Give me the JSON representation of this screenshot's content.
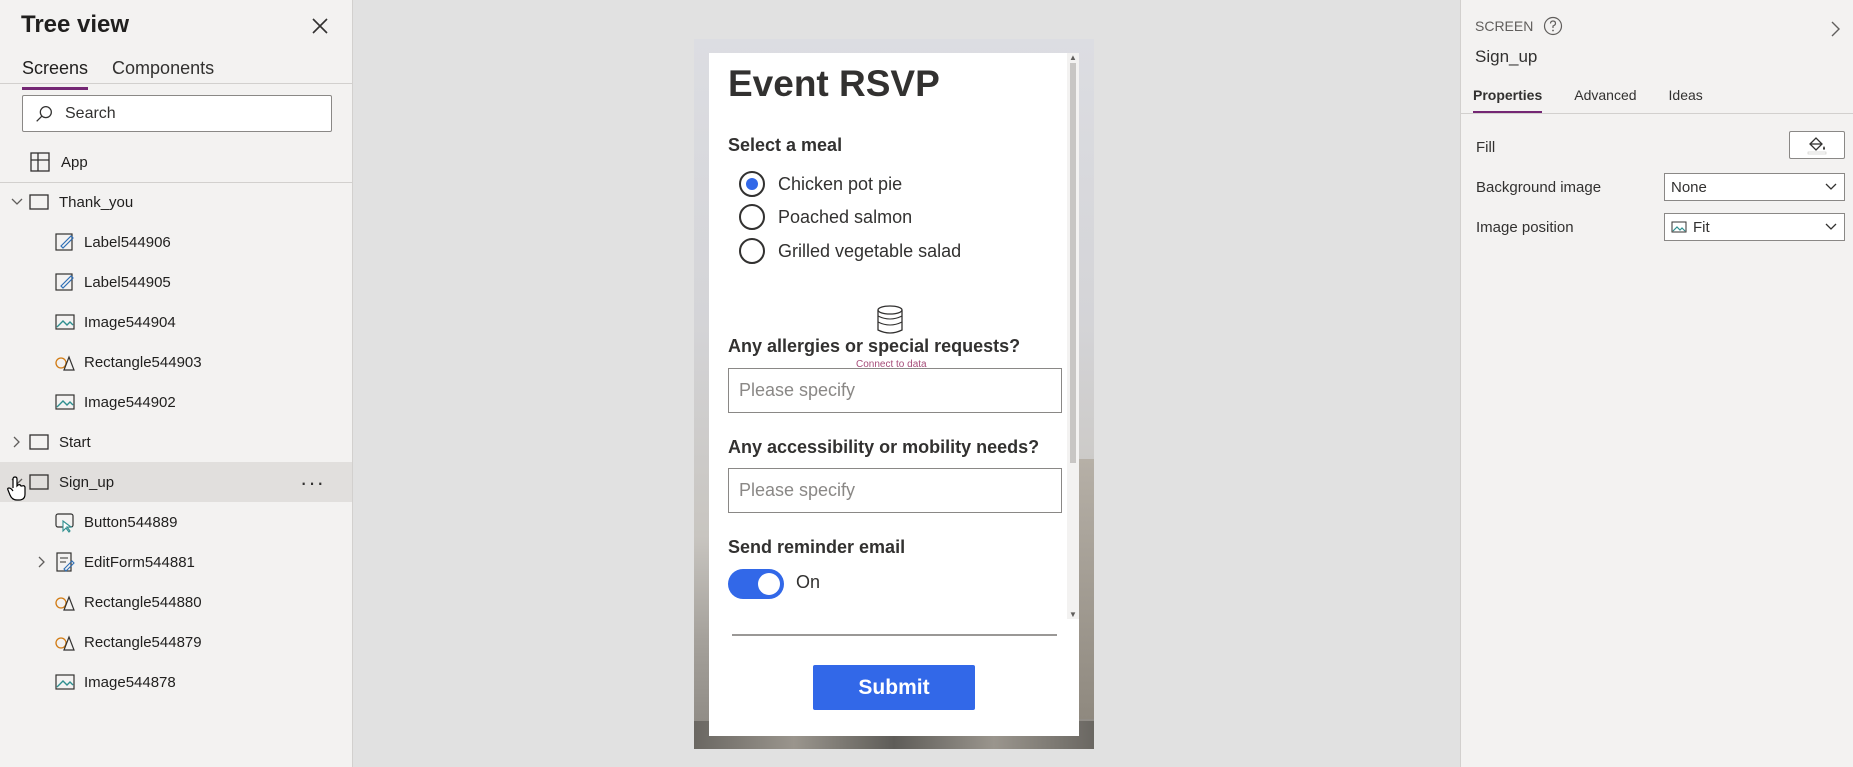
{
  "tree": {
    "title": "Tree view",
    "tabs": [
      "Screens",
      "Components"
    ],
    "search_placeholder": "Search",
    "app_label": "App",
    "items": [
      {
        "label": "Thank_you",
        "kind": "screen"
      },
      {
        "label": "Label544906",
        "kind": "label"
      },
      {
        "label": "Label544905",
        "kind": "label"
      },
      {
        "label": "Image544904",
        "kind": "image"
      },
      {
        "label": "Rectangle544903",
        "kind": "rectangle"
      },
      {
        "label": "Image544902",
        "kind": "image"
      },
      {
        "label": "Start",
        "kind": "screen"
      },
      {
        "label": "Sign_up",
        "kind": "screen"
      },
      {
        "label": "Button544889",
        "kind": "button"
      },
      {
        "label": "EditForm544881",
        "kind": "form"
      },
      {
        "label": "Rectangle544880",
        "kind": "rectangle"
      },
      {
        "label": "Rectangle544879",
        "kind": "rectangle"
      },
      {
        "label": "Image544878",
        "kind": "image"
      }
    ]
  },
  "form": {
    "title": "Event RSVP",
    "meal_label": "Select a meal",
    "meals": [
      "Chicken pot pie",
      "Poached salmon",
      "Grilled vegetable salad"
    ],
    "selected_meal": "Chicken pot pie",
    "allergies_label": "Any allergies or special requests?",
    "allergies_placeholder": "Please specify",
    "accessibility_label": "Any accessibility or mobility needs?",
    "accessibility_placeholder": "Please specify",
    "connect_hint": "Connect to data",
    "reminder_label": "Send reminder email",
    "reminder_state": "On",
    "submit_label": "Submit"
  },
  "props": {
    "kind": "SCREEN",
    "name": "Sign_up",
    "tabs": [
      "Properties",
      "Advanced",
      "Ideas"
    ],
    "fill_label": "Fill",
    "bg_image_label": "Background image",
    "bg_image_value": "None",
    "img_pos_label": "Image position",
    "img_pos_value": "Fit"
  },
  "colors": {
    "accent": "#3268e8",
    "tab_underline": "#742774",
    "selected_row": "#e1dfdd"
  }
}
